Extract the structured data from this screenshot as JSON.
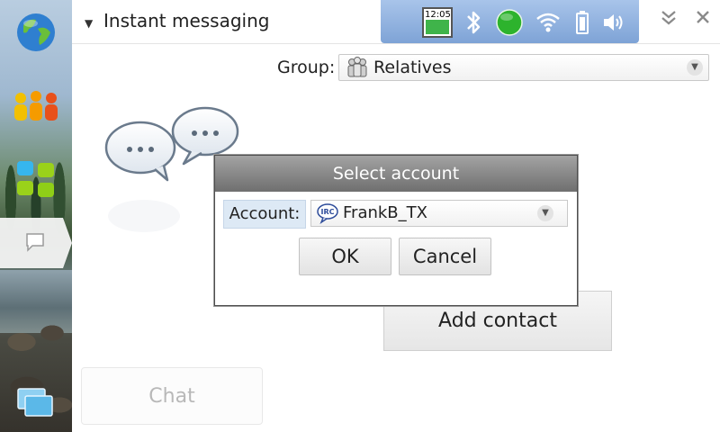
{
  "window": {
    "title": "Instant messaging"
  },
  "status": {
    "clock": "12:05"
  },
  "group": {
    "label": "Group:",
    "value": "Relatives"
  },
  "buttons": {
    "add_contact": "Add contact",
    "chat": "Chat"
  },
  "dialog": {
    "title": "Select account",
    "account_label": "Account:",
    "account_value": "FrankB_TX",
    "account_badge": "IRC",
    "ok_label": "OK",
    "cancel_label": "Cancel"
  },
  "colors": {
    "status_bg": "#8eb0de",
    "dialog_title": "#7d7d7d",
    "presence": "#2db32d"
  },
  "icons": [
    "globe-icon",
    "contacts-group-icon",
    "app-grid-icon",
    "chat-bubble-icon",
    "window-switcher-icon",
    "bluetooth-icon",
    "presence-online-icon",
    "wifi-icon",
    "battery-icon",
    "volume-icon"
  ]
}
